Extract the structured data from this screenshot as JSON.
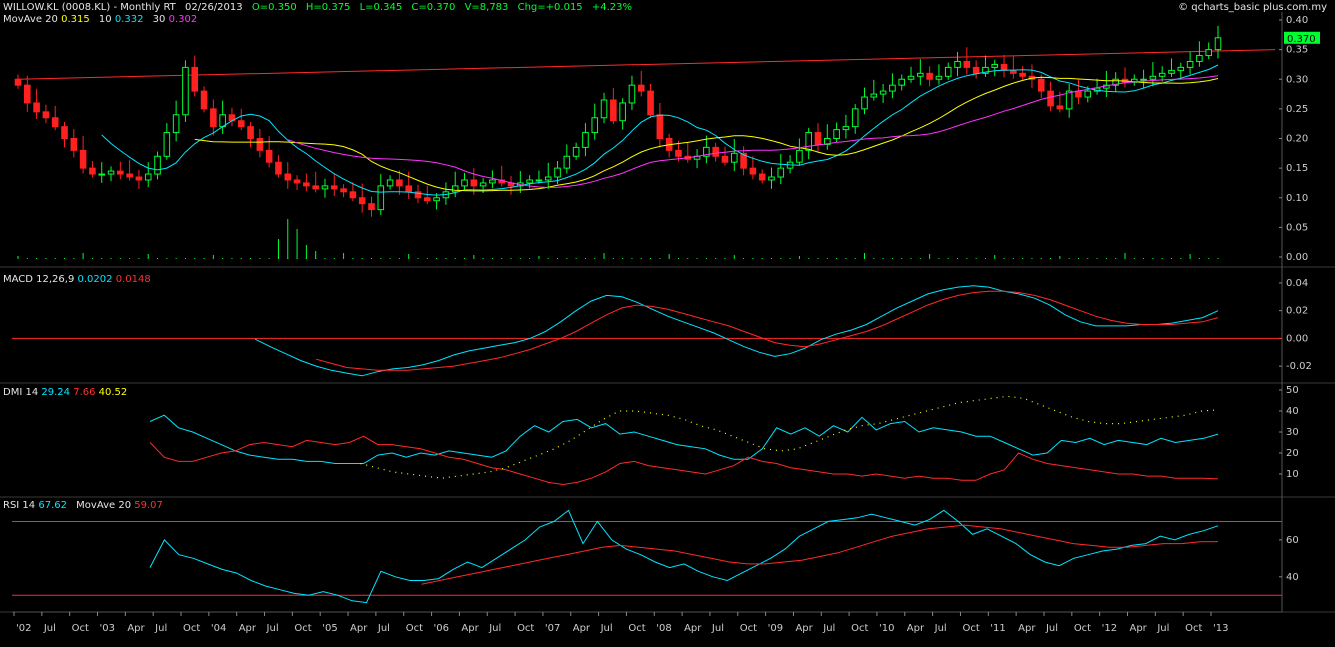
{
  "header": {
    "symbol": "WILLOW.KL (0008.KL) - Monthly RT",
    "date": "02/26/2013",
    "open": "O=0.350",
    "high": "H=0.375",
    "low": "L=0.345",
    "close": "C=0.370",
    "volume": "V=8,783",
    "change": "Chg=+0.015",
    "change_pct": "+4.23%",
    "credit": "© qcharts_basic plus.com.my"
  },
  "price_panel": {
    "movave_label": "MovAve 20",
    "ma20": "0.315",
    "ma10_label": "10",
    "ma10": "0.332",
    "ma30_label": "30",
    "ma30": "0.302",
    "last_price_tag": "0.370"
  },
  "macd_panel": {
    "label": "MACD 12,26,9",
    "macd": "0.0202",
    "signal": "0.0148"
  },
  "dmi_panel": {
    "label": "DMI 14",
    "plus_di": "29.24",
    "minus_di": "7.66",
    "adx": "40.52"
  },
  "rsi_panel": {
    "label": "RSI 14",
    "rsi": "67.62",
    "ma_label": "MovAve 20",
    "ma": "59.07"
  },
  "colors": {
    "background": "#000000",
    "up": "#00ff30",
    "down": "#ff2020",
    "cyan": "#00e5ff",
    "yellow": "#ffff00",
    "magenta": "#ff33ff",
    "red_line": "#ff2a2a",
    "axis": "#cccccc"
  },
  "chart_data": [
    {
      "type": "candlestick",
      "title": "WILLOW.KL (0008.KL) - Monthly RT",
      "yticks": [
        "0.40",
        "0.35",
        "0.30",
        "0.25",
        "0.20",
        "0.15",
        "0.10",
        "0.05",
        "0.00"
      ],
      "ylim": [
        0.0,
        0.4
      ],
      "xticks": [
        "'02",
        "Jul",
        "Oct",
        "'03",
        "Apr",
        "Jul",
        "Oct",
        "'04",
        "Apr",
        "Jul",
        "Oct",
        "'05",
        "Apr",
        "Jul",
        "Oct",
        "'06",
        "Apr",
        "Jul",
        "Oct",
        "'07",
        "Apr",
        "Jul",
        "Oct",
        "'08",
        "Apr",
        "Jul",
        "Oct",
        "'09",
        "Apr",
        "Jul",
        "Oct",
        "'10",
        "Apr",
        "Jul",
        "Oct",
        "'11",
        "Apr",
        "Jul",
        "Oct",
        "'12",
        "Apr",
        "Jul",
        "Oct",
        "'13"
      ],
      "closes": [
        0.29,
        0.26,
        0.245,
        0.235,
        0.22,
        0.2,
        0.18,
        0.15,
        0.14,
        0.14,
        0.145,
        0.14,
        0.135,
        0.13,
        0.14,
        0.17,
        0.21,
        0.24,
        0.32,
        0.28,
        0.25,
        0.22,
        0.24,
        0.23,
        0.22,
        0.2,
        0.18,
        0.16,
        0.14,
        0.13,
        0.125,
        0.12,
        0.115,
        0.12,
        0.115,
        0.11,
        0.1,
        0.09,
        0.08,
        0.12,
        0.13,
        0.12,
        0.11,
        0.1,
        0.095,
        0.1,
        0.11,
        0.12,
        0.13,
        0.12,
        0.125,
        0.13,
        0.125,
        0.12,
        0.125,
        0.13,
        0.13,
        0.135,
        0.15,
        0.17,
        0.185,
        0.21,
        0.235,
        0.265,
        0.23,
        0.26,
        0.29,
        0.28,
        0.24,
        0.2,
        0.18,
        0.17,
        0.165,
        0.17,
        0.185,
        0.17,
        0.16,
        0.175,
        0.15,
        0.14,
        0.13,
        0.135,
        0.15,
        0.16,
        0.18,
        0.21,
        0.19,
        0.2,
        0.215,
        0.22,
        0.25,
        0.27,
        0.275,
        0.28,
        0.29,
        0.3,
        0.305,
        0.31,
        0.3,
        0.305,
        0.32,
        0.33,
        0.32,
        0.31,
        0.32,
        0.325,
        0.315,
        0.31,
        0.305,
        0.3,
        0.28,
        0.255,
        0.25,
        0.28,
        0.27,
        0.28,
        0.285,
        0.29,
        0.3,
        0.295,
        0.3,
        0.3,
        0.305,
        0.31,
        0.315,
        0.32,
        0.33,
        0.34,
        0.35,
        0.37
      ],
      "series": [
        {
          "name": "20",
          "color": "yellow"
        },
        {
          "name": "10",
          "color": "cyan"
        },
        {
          "name": "30",
          "color": "magenta"
        }
      ],
      "trendline": {
        "from": 0.3,
        "to": 0.35
      }
    },
    {
      "type": "line",
      "title": "MACD 12,26,9",
      "yticks": [
        "0.04",
        "0.02",
        "0.00",
        "-0.02"
      ],
      "ylim": [
        -0.03,
        0.045
      ],
      "zero_line": 0.0,
      "series": [
        {
          "name": "MACD",
          "color": "cyan",
          "values": [
            -0.0005,
            -0.006,
            -0.011,
            -0.016,
            -0.02,
            -0.023,
            -0.025,
            -0.027,
            -0.024,
            -0.022,
            -0.021,
            -0.019,
            -0.016,
            -0.012,
            -0.009,
            -0.007,
            -0.005,
            -0.003,
            0.0,
            0.005,
            0.012,
            0.02,
            0.027,
            0.031,
            0.03,
            0.026,
            0.021,
            0.016,
            0.012,
            0.008,
            0.004,
            -0.001,
            -0.006,
            -0.01,
            -0.013,
            -0.011,
            -0.007,
            -0.001,
            0.003,
            0.006,
            0.01,
            0.016,
            0.022,
            0.027,
            0.032,
            0.035,
            0.037,
            0.038,
            0.037,
            0.034,
            0.032,
            0.029,
            0.024,
            0.017,
            0.012,
            0.009,
            0.009,
            0.009,
            0.01,
            0.01,
            0.011,
            0.013,
            0.015,
            0.02
          ]
        },
        {
          "name": "Signal",
          "color": "red",
          "values": [
            null,
            null,
            null,
            null,
            -0.015,
            -0.018,
            -0.021,
            -0.022,
            -0.023,
            -0.023,
            -0.023,
            -0.022,
            -0.021,
            -0.02,
            -0.018,
            -0.016,
            -0.014,
            -0.011,
            -0.008,
            -0.004,
            0.0,
            0.005,
            0.011,
            0.017,
            0.022,
            0.024,
            0.023,
            0.021,
            0.018,
            0.015,
            0.012,
            0.009,
            0.005,
            0.001,
            -0.003,
            -0.005,
            -0.006,
            -0.004,
            -0.001,
            0.002,
            0.005,
            0.009,
            0.014,
            0.019,
            0.024,
            0.028,
            0.031,
            0.033,
            0.034,
            0.034,
            0.033,
            0.031,
            0.028,
            0.024,
            0.02,
            0.016,
            0.013,
            0.011,
            0.01,
            0.01,
            0.01,
            0.011,
            0.012,
            0.015
          ]
        }
      ]
    },
    {
      "type": "line",
      "title": "DMI 14",
      "yticks": [
        "50",
        "40",
        "30",
        "20",
        "10"
      ],
      "ylim": [
        0,
        50
      ],
      "series": [
        {
          "name": "+DI",
          "color": "cyan",
          "values": [
            35,
            38,
            32,
            30,
            27,
            24,
            21,
            19,
            18,
            17,
            17,
            16,
            16,
            15,
            15,
            15,
            19,
            20,
            18,
            20,
            19,
            21,
            20,
            19,
            18,
            21,
            28,
            33,
            30,
            35,
            36,
            32,
            34,
            29,
            30,
            28,
            26,
            24,
            23,
            22,
            19,
            17,
            17,
            22,
            32,
            29,
            32,
            28,
            33,
            30,
            37,
            31,
            34,
            35,
            30,
            32,
            31,
            30,
            28,
            28,
            25,
            22,
            19,
            20,
            26,
            25,
            27,
            24,
            26,
            25,
            24,
            27,
            25,
            26,
            27,
            29
          ]
        },
        {
          "name": "-DI",
          "color": "red",
          "values": [
            25,
            18,
            16,
            16,
            18,
            20,
            21,
            24,
            25,
            24,
            23,
            26,
            25,
            24,
            25,
            28,
            24,
            24,
            23,
            22,
            20,
            18,
            17,
            15,
            13,
            12,
            10,
            8,
            6,
            5,
            6,
            8,
            11,
            15,
            16,
            14,
            13,
            12,
            11,
            10,
            12,
            14,
            18,
            16,
            15,
            13,
            12,
            11,
            10,
            10,
            9,
            10,
            9,
            8,
            9,
            8,
            8,
            7,
            7,
            10,
            12,
            20,
            17,
            15,
            14,
            13,
            12,
            11,
            10,
            10,
            9,
            9,
            8,
            8,
            8,
            7.66
          ]
        },
        {
          "name": "ADX",
          "color": "yellow",
          "values": [
            null,
            null,
            null,
            null,
            null,
            null,
            null,
            null,
            null,
            null,
            null,
            null,
            null,
            15,
            13,
            11,
            10,
            9,
            8,
            9,
            10,
            11,
            13,
            16,
            19,
            22,
            26,
            31,
            36,
            40,
            40,
            39,
            38,
            36,
            33,
            31,
            28,
            25,
            22,
            21,
            22,
            25,
            28,
            31,
            33,
            34,
            36,
            38,
            40,
            42,
            44,
            45,
            46,
            47,
            46,
            43,
            40,
            37,
            35,
            34,
            34,
            35,
            36,
            37,
            38,
            40,
            40.52
          ]
        }
      ]
    },
    {
      "type": "line",
      "title": "RSI 14",
      "yticks": [
        "60",
        "40"
      ],
      "ylim": [
        22,
        80
      ],
      "hlines": [
        70,
        30
      ],
      "series": [
        {
          "name": "RSI",
          "color": "cyan",
          "values": [
            45,
            60,
            52,
            50,
            47,
            44,
            42,
            38,
            35,
            33,
            31,
            30,
            32,
            30,
            27,
            26,
            43,
            40,
            38,
            38,
            39,
            44,
            48,
            45,
            50,
            55,
            60,
            67,
            70,
            76,
            58,
            70,
            60,
            55,
            52,
            48,
            45,
            47,
            43,
            40,
            38,
            42,
            46,
            50,
            55,
            62,
            66,
            70,
            71,
            72,
            74,
            72,
            70,
            68,
            71,
            76,
            70,
            63,
            66,
            62,
            58,
            52,
            48,
            46,
            50,
            52,
            54,
            55,
            57,
            58,
            62,
            60,
            63,
            65,
            67.62
          ]
        },
        {
          "name": "MovAve 20",
          "color": "red",
          "values": [
            null,
            null,
            null,
            null,
            null,
            null,
            null,
            null,
            null,
            null,
            null,
            null,
            null,
            null,
            null,
            36,
            38,
            40,
            42,
            44,
            46,
            48,
            50,
            52,
            54,
            56,
            57,
            56,
            55,
            54,
            52,
            50,
            48,
            47,
            47,
            48,
            49,
            51,
            53,
            56,
            59,
            62,
            64,
            66,
            67,
            68,
            67,
            66,
            64,
            62,
            60,
            58,
            57,
            56,
            56,
            57,
            58,
            58,
            59,
            59.07
          ]
        }
      ]
    }
  ]
}
